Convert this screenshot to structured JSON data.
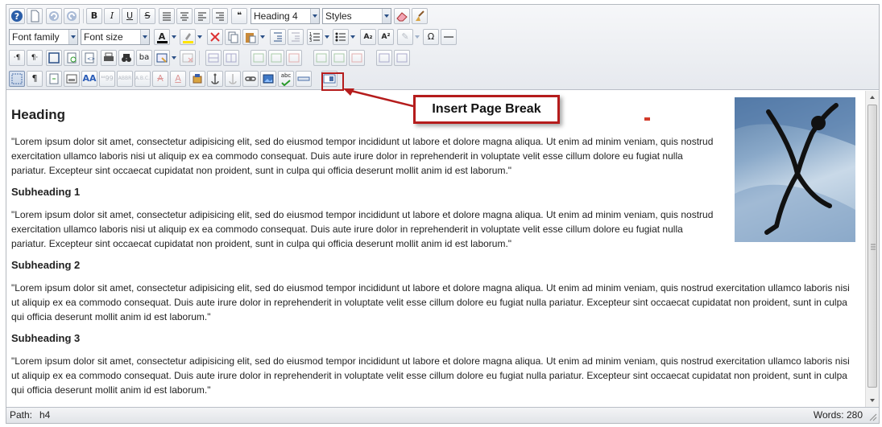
{
  "toolbar": {
    "format_select": "Heading 4",
    "styles_select": "Styles",
    "font_family_select": "Font family",
    "font_size_select": "Font size",
    "icons": {
      "help": "help-icon",
      "new": "new-document-icon",
      "undo": "undo-icon",
      "redo": "redo-icon",
      "bold": "B",
      "italic": "I",
      "underline": "U",
      "strike": "S",
      "justify_full": "justify-full-icon",
      "align_center": "align-center-icon",
      "align_left": "align-left-icon",
      "align_right": "align-right-icon",
      "blockquote": "blockquote-icon",
      "remove_format": "eraser-icon",
      "cleanup": "broom-icon",
      "special_char": "Ω",
      "sub": "A₂",
      "sup": "A²",
      "abbr": "ABBR",
      "acronym": "A.B.C.",
      "cite": "❛❛99",
      "spell": "abc"
    }
  },
  "annotation": {
    "callout": "Insert Page Break"
  },
  "content": {
    "heading": "Heading",
    "para1": "\"Lorem ipsum dolor sit amet, consectetur adipisicing elit, sed do eiusmod tempor incididunt ut labore et dolore magna aliqua. Ut enim ad minim veniam, quis nostrud exercitation ullamco laboris nisi ut aliquip ex ea commodo consequat. Duis aute irure dolor in reprehenderit in voluptate velit esse cillum dolore eu fugiat nulla pariatur. Excepteur sint occaecat cupidatat non proident, sunt in culpa qui officia deserunt mollit anim id est laborum.\"",
    "sub1": "Subheading 1",
    "para2": "\"Lorem ipsum dolor sit amet, consectetur adipisicing elit, sed do eiusmod tempor incididunt ut labore et dolore magna aliqua. Ut enim ad minim veniam, quis nostrud exercitation ullamco laboris nisi ut aliquip ex ea commodo consequat. Duis aute irure dolor in reprehenderit in voluptate velit esse cillum dolore eu fugiat nulla pariatur. Excepteur sint occaecat cupidatat non proident, sunt in culpa qui officia deserunt mollit anim id est laborum.\"",
    "sub2": "Subheading 2",
    "para3": "\"Lorem ipsum dolor sit amet, consectetur adipisicing elit, sed do eiusmod tempor incididunt ut labore et dolore magna aliqua. Ut enim ad minim veniam, quis nostrud exercitation ullamco laboris nisi ut aliquip ex ea commodo consequat. Duis aute irure dolor in reprehenderit in voluptate velit esse cillum dolore eu fugiat nulla pariatur. Excepteur sint occaecat cupidatat non proident, sunt in culpa qui officia deserunt mollit anim id est laborum.\"",
    "sub3": "Subheading 3",
    "para4": "\"Lorem ipsum dolor sit amet, consectetur adipisicing elit, sed do eiusmod tempor incididunt ut labore et dolore magna aliqua. Ut enim ad minim veniam, quis nostrud exercitation ullamco laboris nisi ut aliquip ex ea commodo consequat. Duis aute irure dolor in reprehenderit in voluptate velit esse cillum dolore eu fugiat nulla pariatur. Excepteur sint occaecat cupidatat non proident, sunt in culpa qui officia deserunt mollit anim id est laborum.\""
  },
  "status": {
    "path_label": "Path:",
    "path_value": "h4",
    "words": "Words: 280"
  },
  "colors": {
    "accent_red": "#b51c1c",
    "toolbar_bg": "#e9ecf0"
  }
}
